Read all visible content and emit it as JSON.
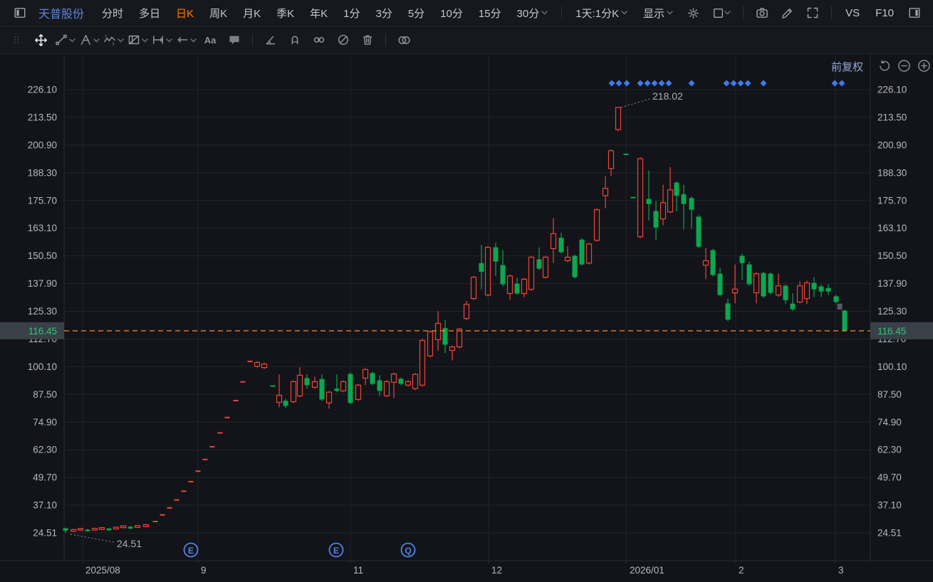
{
  "header": {
    "stock_name": "天普股份",
    "tabs": [
      {
        "label": "分时",
        "active": false,
        "chevron": false
      },
      {
        "label": "多日",
        "active": false,
        "chevron": false
      },
      {
        "label": "日K",
        "active": true,
        "chevron": false
      },
      {
        "label": "周K",
        "active": false,
        "chevron": false
      },
      {
        "label": "月K",
        "active": false,
        "chevron": false
      },
      {
        "label": "季K",
        "active": false,
        "chevron": false
      },
      {
        "label": "年K",
        "active": false,
        "chevron": false
      },
      {
        "label": "1分",
        "active": false,
        "chevron": false
      },
      {
        "label": "3分",
        "active": false,
        "chevron": false
      },
      {
        "label": "5分",
        "active": false,
        "chevron": false
      },
      {
        "label": "10分",
        "active": false,
        "chevron": false
      },
      {
        "label": "15分",
        "active": false,
        "chevron": false
      },
      {
        "label": "30分",
        "active": false,
        "chevron": true
      }
    ],
    "period_selector": "1天:1分K",
    "display_menu": "显示",
    "vs_label": "VS",
    "f10_label": "F10",
    "left_icons": [
      "panel-left-icon"
    ],
    "right_icons_group1": [
      "gear-icon",
      "layout-icon"
    ],
    "right_icons_group2": [
      "camera-icon",
      "pencil-icon",
      "expand-icon"
    ],
    "right_icon_last": "panel-right-icon"
  },
  "drawbar": {
    "tools": [
      "grip",
      "move",
      "trendline",
      "pitchfork",
      "wave",
      "pattern",
      "measure",
      "arrow-left",
      "text",
      "comment",
      "sep",
      "angle",
      "magnet",
      "link",
      "disable",
      "trash",
      "sep",
      "compare",
      "gear"
    ],
    "active_tool": "move"
  },
  "chart": {
    "adjustment_label": "前复权",
    "zoom_controls": [
      "undo-icon",
      "zoom-out-icon",
      "zoom-in-icon"
    ],
    "current_price": "116.45",
    "peak_annotation": "218.02",
    "low_annotation": "24.51",
    "event_markers": [
      {
        "label": "E",
        "x": 268
      },
      {
        "label": "E",
        "x": 472
      },
      {
        "label": "Q",
        "x": 573
      }
    ],
    "diamond_marks_x": [
      859,
      869,
      880,
      899,
      909,
      919,
      929,
      939,
      971,
      1020,
      1030,
      1040,
      1050,
      1072,
      1172,
      1182
    ],
    "y_ticks": [
      "226.10",
      "213.50",
      "200.90",
      "188.30",
      "175.70",
      "163.10",
      "150.50",
      "137.90",
      "125.30",
      "112.70",
      "100.10",
      "87.50",
      "74.90",
      "62.30",
      "49.70",
      "37.10",
      "24.51"
    ],
    "x_labels": [
      {
        "text": "2025/08",
        "x": 120,
        "grid_x": 116
      },
      {
        "text": "9",
        "x": 282,
        "grid_x": 278
      },
      {
        "text": "11",
        "x": 496,
        "grid_x": 492
      },
      {
        "text": "12",
        "x": 690,
        "grid_x": 686
      },
      {
        "text": "2026/01",
        "x": 884,
        "grid_x": 879
      },
      {
        "text": "2",
        "x": 1037,
        "grid_x": 1033
      },
      {
        "text": "3",
        "x": 1177,
        "grid_x": 1173
      }
    ]
  },
  "chart_data": {
    "type": "candlestick",
    "title": "天普股份 日K 前复权",
    "y_axis_range": [
      24.51,
      226.1
    ],
    "current_price": 116.45,
    "peak_price": 218.02,
    "low_price": 24.51,
    "grid": true,
    "note": "t: u = up/red hollow, d = down/green solid, f = flat/gray; fields o,c,l,h in price units; x in px",
    "candles": [
      {
        "x": 92,
        "t": "d",
        "o": 26.6,
        "c": 25.5,
        "l": 24.51,
        "h": 26.9
      },
      {
        "x": 103,
        "t": "u",
        "o": 25.3,
        "c": 26.0,
        "l": 25.0,
        "h": 26.3
      },
      {
        "x": 113,
        "t": "u",
        "o": 25.8,
        "c": 26.5,
        "l": 25.5,
        "h": 26.8
      },
      {
        "x": 123,
        "t": "d",
        "o": 26.0,
        "c": 25.3,
        "l": 25.0,
        "h": 26.3
      },
      {
        "x": 133,
        "t": "u",
        "o": 25.8,
        "c": 26.5,
        "l": 25.5,
        "h": 26.9
      },
      {
        "x": 143,
        "t": "u",
        "o": 26.1,
        "c": 26.9,
        "l": 25.8,
        "h": 27.2
      },
      {
        "x": 153,
        "t": "d",
        "o": 26.5,
        "c": 25.7,
        "l": 25.4,
        "h": 26.8
      },
      {
        "x": 163,
        "t": "u",
        "o": 26.3,
        "c": 27.1,
        "l": 26.0,
        "h": 27.4
      },
      {
        "x": 173,
        "t": "u",
        "o": 26.9,
        "c": 27.7,
        "l": 26.5,
        "h": 28.0
      },
      {
        "x": 183,
        "t": "d",
        "o": 27.3,
        "c": 26.5,
        "l": 26.2,
        "h": 27.6
      },
      {
        "x": 193,
        "t": "u",
        "o": 27.0,
        "c": 27.8,
        "l": 26.7,
        "h": 28.1
      },
      {
        "x": 205,
        "t": "u",
        "o": 27.4,
        "c": 28.2,
        "l": 27.1,
        "h": 28.7
      },
      {
        "x": 218,
        "t": "u",
        "o": 29.7,
        "c": 29.7,
        "l": 29.7,
        "h": 29.7
      },
      {
        "x": 228,
        "t": "u",
        "o": 32.7,
        "c": 32.7,
        "l": 32.7,
        "h": 32.7
      },
      {
        "x": 238,
        "t": "u",
        "o": 35.9,
        "c": 35.9,
        "l": 35.9,
        "h": 35.9
      },
      {
        "x": 248,
        "t": "u",
        "o": 39.5,
        "c": 39.5,
        "l": 39.5,
        "h": 39.5
      },
      {
        "x": 258,
        "t": "u",
        "o": 43.5,
        "c": 43.5,
        "l": 43.5,
        "h": 43.5
      },
      {
        "x": 268,
        "t": "u",
        "o": 47.8,
        "c": 47.8,
        "l": 47.8,
        "h": 47.8
      },
      {
        "x": 278,
        "t": "u",
        "o": 52.6,
        "c": 52.6,
        "l": 52.6,
        "h": 52.6
      },
      {
        "x": 288,
        "t": "u",
        "o": 57.9,
        "c": 57.9,
        "l": 57.9,
        "h": 57.9
      },
      {
        "x": 298,
        "t": "u",
        "o": 63.7,
        "c": 63.7,
        "l": 63.7,
        "h": 63.7
      },
      {
        "x": 309,
        "t": "u",
        "o": 70.0,
        "c": 70.0,
        "l": 70.0,
        "h": 70.0
      },
      {
        "x": 319,
        "t": "u",
        "o": 77.0,
        "c": 77.0,
        "l": 77.0,
        "h": 77.0
      },
      {
        "x": 331,
        "t": "u",
        "o": 84.7,
        "c": 84.7,
        "l": 84.7,
        "h": 84.7
      },
      {
        "x": 341,
        "t": "u",
        "o": 93.2,
        "c": 93.2,
        "l": 93.2,
        "h": 93.2
      },
      {
        "x": 351,
        "t": "u",
        "o": 102.5,
        "c": 102.5,
        "l": 102.5,
        "h": 102.5
      },
      {
        "x": 361,
        "t": "u",
        "o": 100.3,
        "c": 102.0,
        "l": 99.7,
        "h": 102.6
      },
      {
        "x": 371,
        "t": "u",
        "o": 99.7,
        "c": 101.3,
        "l": 99.0,
        "h": 102.0
      },
      {
        "x": 383,
        "t": "d",
        "o": 91.3,
        "c": 91.3,
        "l": 91.3,
        "h": 91.3
      },
      {
        "x": 392,
        "t": "u",
        "o": 83.9,
        "c": 87.1,
        "l": 81.6,
        "h": 96.6
      },
      {
        "x": 401,
        "t": "d",
        "o": 84.6,
        "c": 82.3,
        "l": 81.3,
        "h": 85.5
      },
      {
        "x": 412,
        "t": "u",
        "o": 84.2,
        "c": 93.3,
        "l": 83.5,
        "h": 93.9
      },
      {
        "x": 421,
        "t": "u",
        "o": 86.8,
        "c": 96.2,
        "l": 86.2,
        "h": 99.8
      },
      {
        "x": 431,
        "t": "d",
        "o": 94.9,
        "c": 91.7,
        "l": 90.1,
        "h": 96.6
      },
      {
        "x": 442,
        "t": "u",
        "o": 90.7,
        "c": 93.3,
        "l": 90.0,
        "h": 95.5
      },
      {
        "x": 452,
        "t": "d",
        "o": 94.5,
        "c": 85.2,
        "l": 84.5,
        "h": 96.5
      },
      {
        "x": 462,
        "t": "u",
        "o": 83.6,
        "c": 88.5,
        "l": 81.0,
        "h": 89.1
      },
      {
        "x": 473,
        "t": "d",
        "o": 90.1,
        "c": 89.1,
        "l": 88.5,
        "h": 96.6
      },
      {
        "x": 482,
        "t": "u",
        "o": 89.1,
        "c": 93.3,
        "l": 88.5,
        "h": 93.9
      },
      {
        "x": 492,
        "t": "d",
        "o": 96.8,
        "c": 83.6,
        "l": 83.0,
        "h": 97.4
      },
      {
        "x": 503,
        "t": "u",
        "o": 85.2,
        "c": 91.7,
        "l": 84.5,
        "h": 92.3
      },
      {
        "x": 513,
        "t": "u",
        "o": 94.9,
        "c": 98.8,
        "l": 91.7,
        "h": 99.4
      },
      {
        "x": 523,
        "t": "d",
        "o": 97.2,
        "c": 92.3,
        "l": 91.7,
        "h": 97.8
      },
      {
        "x": 533,
        "t": "d",
        "o": 93.9,
        "c": 89.1,
        "l": 86.9,
        "h": 96.2
      },
      {
        "x": 543,
        "t": "u",
        "o": 86.9,
        "c": 93.3,
        "l": 86.2,
        "h": 93.9
      },
      {
        "x": 553,
        "t": "u",
        "o": 93.0,
        "c": 96.8,
        "l": 85.9,
        "h": 97.4
      },
      {
        "x": 563,
        "t": "d",
        "o": 94.6,
        "c": 92.3,
        "l": 91.7,
        "h": 95.2
      },
      {
        "x": 573,
        "t": "u",
        "o": 91.7,
        "c": 93.3,
        "l": 91.0,
        "h": 93.9
      },
      {
        "x": 583,
        "t": "u",
        "o": 90.1,
        "c": 96.6,
        "l": 89.4,
        "h": 97.2
      },
      {
        "x": 593,
        "t": "u",
        "o": 91.7,
        "c": 112.0,
        "l": 91.0,
        "h": 112.8
      },
      {
        "x": 604,
        "t": "u",
        "o": 105.0,
        "c": 116.0,
        "l": 104.3,
        "h": 116.6
      },
      {
        "x": 615,
        "t": "u",
        "o": 112.4,
        "c": 119.8,
        "l": 107.3,
        "h": 125.3
      },
      {
        "x": 625,
        "t": "d",
        "o": 117.6,
        "c": 110.1,
        "l": 106.3,
        "h": 121.4
      },
      {
        "x": 635,
        "t": "u",
        "o": 107.5,
        "c": 109.1,
        "l": 103.0,
        "h": 109.7
      },
      {
        "x": 645,
        "t": "u",
        "o": 109.1,
        "c": 117.2,
        "l": 108.4,
        "h": 117.8
      },
      {
        "x": 655,
        "t": "u",
        "o": 122.0,
        "c": 128.5,
        "l": 121.3,
        "h": 130.0
      },
      {
        "x": 665,
        "t": "u",
        "o": 131.1,
        "c": 140.8,
        "l": 130.4,
        "h": 141.4
      },
      {
        "x": 676,
        "t": "d",
        "o": 147.2,
        "c": 143.3,
        "l": 135.3,
        "h": 155.4
      },
      {
        "x": 685,
        "t": "u",
        "o": 132.7,
        "c": 154.4,
        "l": 132.0,
        "h": 155.0
      },
      {
        "x": 696,
        "t": "d",
        "o": 154.4,
        "c": 147.9,
        "l": 141.4,
        "h": 156.4
      },
      {
        "x": 706,
        "t": "d",
        "o": 146.3,
        "c": 137.6,
        "l": 136.6,
        "h": 153.1
      },
      {
        "x": 716,
        "t": "u",
        "o": 133.4,
        "c": 141.4,
        "l": 130.5,
        "h": 142.0
      },
      {
        "x": 726,
        "t": "d",
        "o": 137.9,
        "c": 133.4,
        "l": 132.8,
        "h": 140.5
      },
      {
        "x": 736,
        "t": "u",
        "o": 133.4,
        "c": 139.9,
        "l": 131.8,
        "h": 140.5
      },
      {
        "x": 746,
        "t": "u",
        "o": 135.3,
        "c": 149.9,
        "l": 134.6,
        "h": 150.5
      },
      {
        "x": 757,
        "t": "d",
        "o": 148.9,
        "c": 144.7,
        "l": 144.0,
        "h": 154.4
      },
      {
        "x": 766,
        "t": "u",
        "o": 140.8,
        "c": 149.9,
        "l": 140.2,
        "h": 150.5
      },
      {
        "x": 777,
        "t": "u",
        "o": 153.8,
        "c": 160.6,
        "l": 147.3,
        "h": 167.7
      },
      {
        "x": 788,
        "t": "d",
        "o": 158.7,
        "c": 152.2,
        "l": 151.5,
        "h": 161.0
      },
      {
        "x": 797,
        "t": "u",
        "o": 148.3,
        "c": 149.9,
        "l": 147.7,
        "h": 154.8
      },
      {
        "x": 807,
        "t": "d",
        "o": 150.5,
        "c": 140.8,
        "l": 140.2,
        "h": 151.1
      },
      {
        "x": 817,
        "t": "d",
        "o": 157.9,
        "c": 146.6,
        "l": 146.0,
        "h": 158.5
      },
      {
        "x": 827,
        "t": "u",
        "o": 147.2,
        "c": 155.9,
        "l": 146.6,
        "h": 156.5
      },
      {
        "x": 838,
        "t": "u",
        "o": 157.6,
        "c": 171.5,
        "l": 157.0,
        "h": 172.1
      },
      {
        "x": 850,
        "t": "u",
        "o": 177.9,
        "c": 181.2,
        "l": 172.1,
        "h": 186.7
      },
      {
        "x": 858,
        "t": "u",
        "o": 190.2,
        "c": 198.3,
        "l": 186.9,
        "h": 198.9
      },
      {
        "x": 868,
        "t": "u",
        "o": 207.9,
        "c": 218.02,
        "l": 207.2,
        "h": 218.02
      },
      {
        "x": 879,
        "t": "d",
        "o": 196.7,
        "c": 196.7,
        "l": 196.7,
        "h": 196.7
      },
      {
        "x": 889,
        "t": "d",
        "o": 177.0,
        "c": 177.0,
        "l": 177.0,
        "h": 177.0
      },
      {
        "x": 899,
        "t": "u",
        "o": 159.2,
        "c": 194.7,
        "l": 158.5,
        "h": 195.3
      },
      {
        "x": 911,
        "t": "d",
        "o": 176.4,
        "c": 174.1,
        "l": 166.6,
        "h": 189.3
      },
      {
        "x": 921,
        "t": "d",
        "o": 170.9,
        "c": 163.4,
        "l": 157.9,
        "h": 175.4
      },
      {
        "x": 931,
        "t": "u",
        "o": 167.3,
        "c": 174.7,
        "l": 164.4,
        "h": 182.8
      },
      {
        "x": 941,
        "t": "u",
        "o": 170.5,
        "c": 180.5,
        "l": 169.9,
        "h": 190.9
      },
      {
        "x": 950,
        "t": "d",
        "o": 183.8,
        "c": 177.9,
        "l": 170.8,
        "h": 184.4
      },
      {
        "x": 960,
        "t": "d",
        "o": 178.5,
        "c": 174.1,
        "l": 162.5,
        "h": 182.8
      },
      {
        "x": 971,
        "t": "d",
        "o": 176.8,
        "c": 171.5,
        "l": 162.8,
        "h": 177.5
      },
      {
        "x": 981,
        "t": "d",
        "o": 168.3,
        "c": 154.7,
        "l": 154.0,
        "h": 169.0
      },
      {
        "x": 991,
        "t": "u",
        "o": 146.3,
        "c": 148.3,
        "l": 139.9,
        "h": 154.1
      },
      {
        "x": 1001,
        "t": "d",
        "o": 153.1,
        "c": 141.8,
        "l": 141.2,
        "h": 153.7
      },
      {
        "x": 1011,
        "t": "d",
        "o": 142.4,
        "c": 132.7,
        "l": 132.1,
        "h": 145.0
      },
      {
        "x": 1022,
        "t": "d",
        "o": 128.9,
        "c": 121.5,
        "l": 120.8,
        "h": 131.1
      },
      {
        "x": 1032,
        "t": "u",
        "o": 133.7,
        "c": 135.4,
        "l": 128.9,
        "h": 146.6
      },
      {
        "x": 1042,
        "t": "d",
        "o": 150.5,
        "c": 147.2,
        "l": 139.7,
        "h": 151.5
      },
      {
        "x": 1052,
        "t": "d",
        "o": 146.6,
        "c": 137.6,
        "l": 136.9,
        "h": 147.9
      },
      {
        "x": 1062,
        "t": "u",
        "o": 133.7,
        "c": 142.4,
        "l": 128.9,
        "h": 143.0
      },
      {
        "x": 1072,
        "t": "d",
        "o": 142.7,
        "c": 132.1,
        "l": 131.4,
        "h": 143.3
      },
      {
        "x": 1082,
        "t": "d",
        "o": 142.4,
        "c": 133.7,
        "l": 133.0,
        "h": 143.0
      },
      {
        "x": 1093,
        "t": "u",
        "o": 132.7,
        "c": 136.9,
        "l": 131.8,
        "h": 142.4
      },
      {
        "x": 1103,
        "t": "d",
        "o": 136.9,
        "c": 130.4,
        "l": 128.6,
        "h": 137.5
      },
      {
        "x": 1113,
        "t": "d",
        "o": 128.8,
        "c": 126.2,
        "l": 125.5,
        "h": 133.5
      },
      {
        "x": 1123,
        "t": "u",
        "o": 129.5,
        "c": 136.9,
        "l": 128.9,
        "h": 138.9
      },
      {
        "x": 1133,
        "t": "u",
        "o": 131.1,
        "c": 138.2,
        "l": 128.6,
        "h": 139.2
      },
      {
        "x": 1143,
        "t": "d",
        "o": 138.2,
        "c": 135.3,
        "l": 131.8,
        "h": 140.8
      },
      {
        "x": 1153,
        "t": "d",
        "o": 136.6,
        "c": 134.3,
        "l": 131.8,
        "h": 137.5
      },
      {
        "x": 1163,
        "t": "d",
        "o": 135.9,
        "c": 134.3,
        "l": 132.8,
        "h": 137.5
      },
      {
        "x": 1174,
        "t": "d",
        "o": 132.1,
        "c": 129.5,
        "l": 128.9,
        "h": 132.7
      },
      {
        "x": 1179,
        "t": "f",
        "o": 128.8,
        "c": 126.1,
        "l": 126.1,
        "h": 128.8
      },
      {
        "x": 1186,
        "t": "d",
        "o": 125.6,
        "c": 116.45,
        "l": 116.0,
        "h": 126.0
      }
    ]
  },
  "colors": {
    "up_red": "#ef4437",
    "down_green": "#0ca750",
    "flat_gray": "#555b66",
    "price_line_orange": "#f07c1c",
    "price_label_green": "#2bc878",
    "price_label_box": "#3a4048",
    "diamond_blue": "#3e7bf0",
    "marker_blue": "#4a86e8",
    "grid": "#232529",
    "axis_text": "#b2b8c2",
    "accent_blue_text": "#8fa6d6",
    "tab_active_orange": "#ff7d00",
    "stock_name_blue": "#5d86d8",
    "background": "#131419"
  }
}
